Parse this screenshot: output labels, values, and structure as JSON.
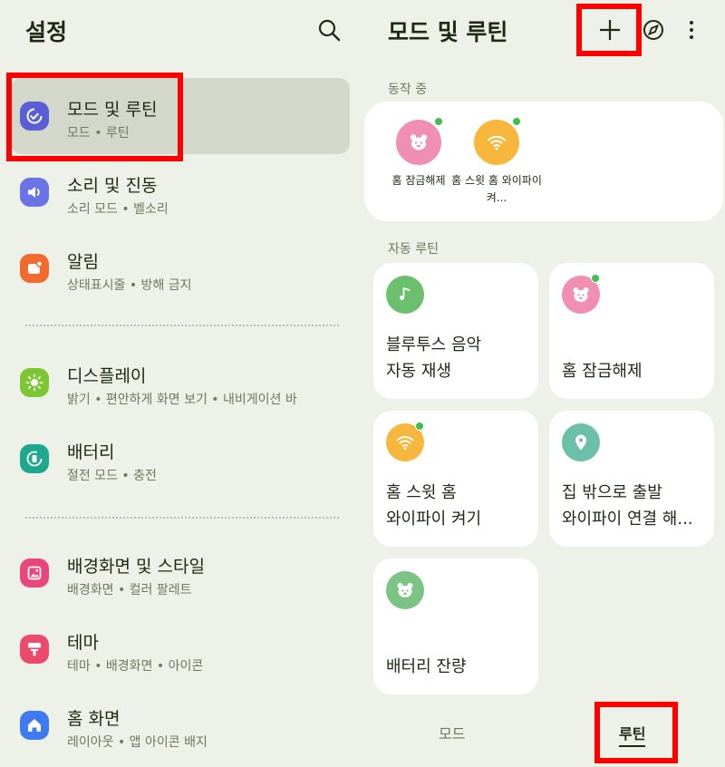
{
  "settings": {
    "title": "설정",
    "search_icon": "search-icon",
    "items": [
      {
        "title": "모드 및 루틴",
        "subtitle": "모드 • 루틴",
        "icon": "routine-check-icon",
        "color": "#5b5fd6"
      },
      {
        "title": "소리 및 진동",
        "subtitle": "소리 모드 • 벨소리",
        "icon": "speaker-icon",
        "color": "#6a74e6"
      },
      {
        "title": "알림",
        "subtitle": "상태표시줄 • 방해 금지",
        "icon": "notification-icon",
        "color": "#f26a2e"
      },
      {
        "title": "디스플레이",
        "subtitle": "밝기 • 편안하게 화면 보기 • 내비게이션 바",
        "icon": "brightness-icon",
        "color": "#7dc634"
      },
      {
        "title": "배터리",
        "subtitle": "절전 모드 • 충전",
        "icon": "battery-icon",
        "color": "#1fa88f"
      },
      {
        "title": "배경화면 및 스타일",
        "subtitle": "배경화면 • 컬러 팔레트",
        "icon": "wallpaper-icon",
        "color": "#e9467b"
      },
      {
        "title": "테마",
        "subtitle": "테마 • 배경화면 • 아이콘",
        "icon": "theme-brush-icon",
        "color": "#ec4a6c"
      },
      {
        "title": "홈 화면",
        "subtitle": "레이아웃 • 앱 아이콘 배지",
        "icon": "home-icon",
        "color": "#3f7af0"
      }
    ]
  },
  "routines": {
    "title": "모드 및 루틴",
    "add_icon": "plus-icon",
    "discover_icon": "compass-icon",
    "more_icon": "more-vertical-icon",
    "active_label": "동작 중",
    "active": [
      {
        "name": "홈 잠금해제",
        "icon": "bear-face-icon",
        "color": "#f08fb2"
      },
      {
        "name": "홈 스윗 홈 와이파이 켜...",
        "icon": "wifi-icon",
        "color": "#f6b73c"
      }
    ],
    "auto_label": "자동 루틴",
    "cards": [
      {
        "line1": "블루투스 음악",
        "line2": "자동 재생",
        "icon": "music-note-icon",
        "color": "#6cbf6c"
      },
      {
        "line1": "",
        "line2": "홈 잠금해제",
        "icon": "bear-face-icon",
        "color": "#f08fb2"
      },
      {
        "line1": "홈 스윗 홈",
        "line2": "와이파이 켜기",
        "icon": "wifi-icon",
        "color": "#f6b73c"
      },
      {
        "line1": "집 밖으로 출발",
        "line2": "와이파이 연결 해...",
        "icon": "location-pin-icon",
        "color": "#6cbfa8"
      },
      {
        "line1": "",
        "line2": "배터리 잔량",
        "icon": "bear-face-icon",
        "color": "#7cc484"
      }
    ],
    "tabs": {
      "mode": "모드",
      "routine": "루틴"
    }
  },
  "colors": {
    "highlight": "#ff0000",
    "active_dot": "#3fbf4e",
    "selected_item": "#d4d8cb"
  }
}
